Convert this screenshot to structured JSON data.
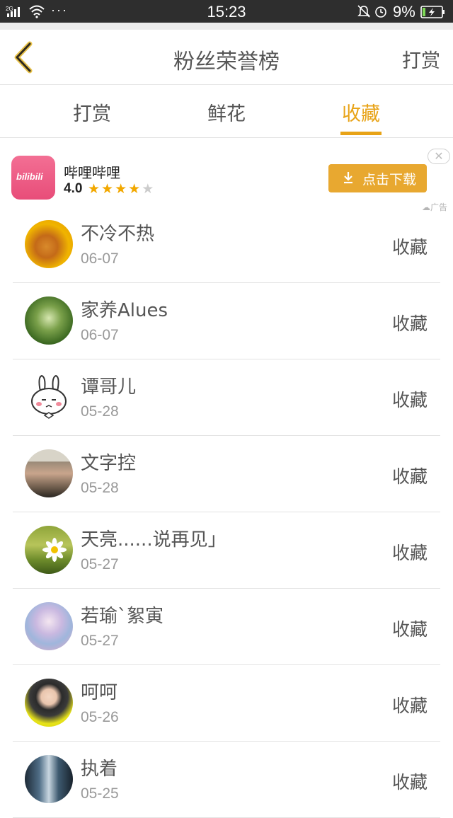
{
  "status_bar": {
    "network": "2G",
    "dots": "···",
    "time": "15:23",
    "battery": "9%",
    "icons": [
      "signal-icon",
      "wifi-icon",
      "bell-off-icon",
      "alarm-icon",
      "battery-charging-icon"
    ]
  },
  "header": {
    "title": "粉丝荣誉榜",
    "right_action": "打赏",
    "back_icon": "chevron-left-icon"
  },
  "tabs": [
    {
      "label": "打赏",
      "active": false
    },
    {
      "label": "鲜花",
      "active": false
    },
    {
      "label": "收藏",
      "active": true
    }
  ],
  "ad": {
    "app_name": "哔哩哔哩",
    "rating": "4.0",
    "stars_filled": 4,
    "stars_total": 5,
    "button_label": "点击下载",
    "tag": "广告",
    "logo_text": "bilibili"
  },
  "fans": [
    {
      "name": "不冷不热",
      "date": "06-07",
      "action": "收藏"
    },
    {
      "name": "家养Alues",
      "date": "06-07",
      "action": "收藏"
    },
    {
      "name": "谭哥儿",
      "date": "05-28",
      "action": "收藏"
    },
    {
      "name": "文字控",
      "date": "05-28",
      "action": "收藏"
    },
    {
      "name": "天亮......说再见」",
      "date": "05-27",
      "action": "收藏"
    },
    {
      "name": "若瑜`絮寅",
      "date": "05-27",
      "action": "收藏"
    },
    {
      "name": "呵呵",
      "date": "05-26",
      "action": "收藏"
    },
    {
      "name": " 执着",
      "date": "05-25",
      "action": "收藏"
    }
  ],
  "colors": {
    "accent": "#e8a317",
    "status_bar": "#2e2e2e",
    "text": "#555555",
    "subtext": "#999999"
  }
}
